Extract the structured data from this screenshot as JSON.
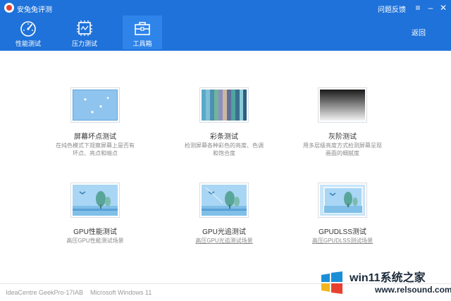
{
  "app": {
    "title": "安兔兔评测",
    "feedback": "问题反馈",
    "back": "返回"
  },
  "tabs": [
    {
      "label": "性能测试",
      "icon": "speedometer-icon"
    },
    {
      "label": "压力测试",
      "icon": "chip-icon"
    },
    {
      "label": "工具箱",
      "icon": "toolbox-icon",
      "active": true
    }
  ],
  "tools": [
    {
      "title": "屏幕坏点测试",
      "desc_lines": [
        "在纯色模式下观察屏幕上是否有",
        "坏点、亮点和暗点"
      ],
      "icon": "screen-icon"
    },
    {
      "title": "彩条测试",
      "desc_lines": [
        "检测屏幕各种彩色的亮度、色调",
        "和饱合度"
      ],
      "icon": "color-bars-icon"
    },
    {
      "title": "灰阶测试",
      "desc_lines": [
        "用多层级亮度方式检测屏幕呈现",
        "画面的细腻度"
      ],
      "icon": "grayscale-icon"
    },
    {
      "title": "GPU性能测试",
      "desc_lines": [
        "高压GPU性能测试场景"
      ],
      "icon": "gpu-scene-icon"
    },
    {
      "title": "GPU光追测试",
      "desc_lines": [
        "高压GPU光追测试场景"
      ],
      "icon": "raytracing-scene-icon"
    },
    {
      "title": "GPUDLSS测试",
      "desc_lines": [
        "高压GPUDLSS测试场景"
      ],
      "icon": "dlss-scene-icon"
    }
  ],
  "footer": {
    "device": "IdeaCentre GeekPro-17IAB",
    "os": "Microsoft Windows 11"
  },
  "watermark": {
    "title": "win11系统之家",
    "url": "www.relsound.com"
  },
  "colors": {
    "header": "#1f72d9",
    "active_tab": "#2f84ea",
    "sky": "#9fcff2",
    "tree": "#5aa59a"
  }
}
